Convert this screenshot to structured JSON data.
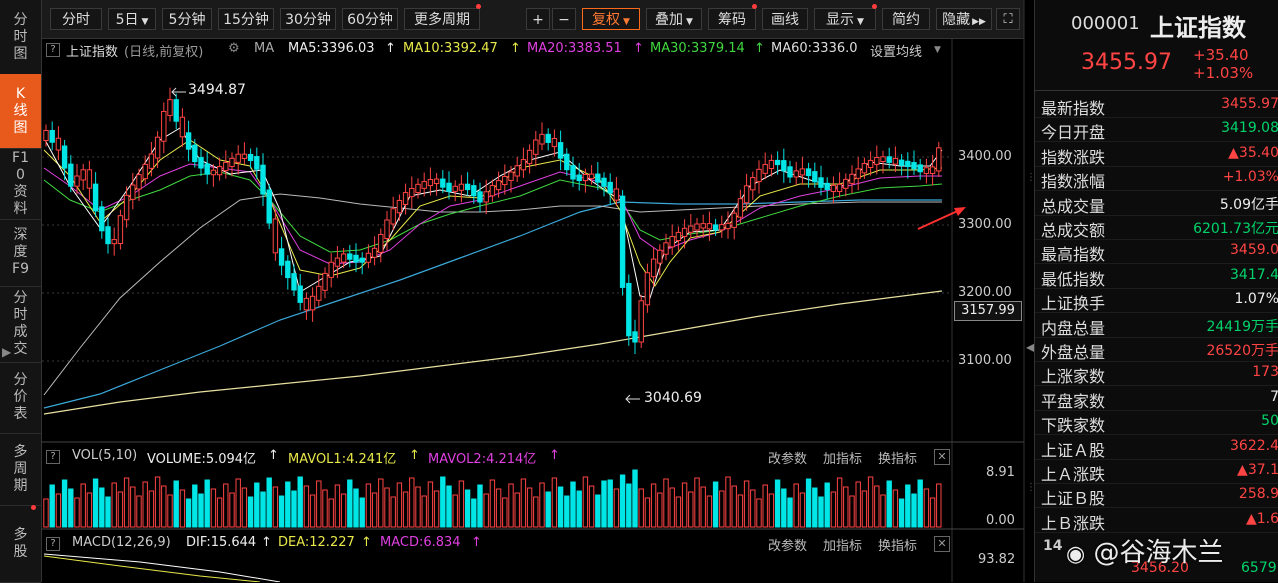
{
  "left_nav": [
    {
      "label": "分时图",
      "active": false
    },
    {
      "label": "K线图",
      "active": true
    },
    {
      "label": "F10资料",
      "active": false
    },
    {
      "label": "深度F9",
      "active": false
    },
    {
      "label": "分时成交",
      "active": false
    },
    {
      "label": "分价表",
      "active": false
    },
    {
      "label": "多周期",
      "active": false
    },
    {
      "label": "多股",
      "active": false
    }
  ],
  "toolbar": {
    "periods": [
      "分时",
      "5日",
      "5分钟",
      "15分钟",
      "30分钟",
      "60分钟",
      "更多周期"
    ],
    "fuquan": "复权",
    "diejia": "叠加",
    "chouma": "筹码",
    "huaxian": "画线",
    "xianshi": "显示",
    "jianyue": "简约",
    "yincang": "隐藏",
    "plus": "+",
    "minus": "−"
  },
  "chart_header": {
    "name": "上证指数",
    "mode": "(日线,前复权)",
    "ma_label": "MA",
    "ma5": "MA5:3396.03",
    "ma10": "MA10:3392.47",
    "ma20": "MA20:3383.51",
    "ma30": "MA30:3379.14",
    "ma60": "MA60:3336.0",
    "settings": "设置均线"
  },
  "annotations": {
    "high": "3494.87",
    "low": "3040.69"
  },
  "y_axis": [
    "3400.00",
    "3300.00",
    "3200.00",
    "3100.00"
  ],
  "current_price_tag": "3157.99",
  "volume_panel": {
    "title": "VOL(5,10)",
    "volume": "VOLUME:5.094亿",
    "mavol1": "MAVOL1:4.241亿",
    "mavol2": "MAVOL2:4.214亿",
    "buttons": [
      "改参数",
      "加指标",
      "换指标"
    ],
    "axis_top": "8.91",
    "axis_bottom": "0.00"
  },
  "macd_panel": {
    "title": "MACD(12,26,9)",
    "dif": "DIF:15.644",
    "dea": "DEA:12.227",
    "macd": "MACD:6.834",
    "buttons": [
      "改参数",
      "加指标",
      "换指标"
    ],
    "axis_top": "93.82"
  },
  "quote": {
    "code": "000001",
    "name": "上证指数",
    "price": "3455.97",
    "change": "+35.40",
    "change_pct": "+1.03%"
  },
  "stats": [
    {
      "label": "最新指数",
      "value": "3455.97",
      "color": "red"
    },
    {
      "label": "今日开盘",
      "value": "3419.08",
      "color": "green"
    },
    {
      "label": "指数涨跌",
      "value": "▲35.40",
      "color": "red"
    },
    {
      "label": "指数涨幅",
      "value": "+1.03%",
      "color": "red"
    },
    {
      "label": "总成交量",
      "value": "5.09亿手",
      "color": "white"
    },
    {
      "label": "总成交额",
      "value": "6201.73亿元",
      "color": "green"
    },
    {
      "label": "最高指数",
      "value": "3459.0",
      "color": "red"
    },
    {
      "label": "最低指数",
      "value": "3417.4",
      "color": "green"
    },
    {
      "label": "上证换手",
      "value": "1.07%",
      "color": "white"
    },
    {
      "label": "内盘总量",
      "value": "24419万手",
      "color": "green"
    },
    {
      "label": "外盘总量",
      "value": "26520万手",
      "color": "red"
    },
    {
      "label": "上涨家数",
      "value": "173",
      "color": "red"
    },
    {
      "label": "平盘家数",
      "value": "7",
      "color": "white"
    },
    {
      "label": "下跌家数",
      "value": "50",
      "color": "green"
    },
    {
      "label": "上证Ａ股",
      "value": "3622.4",
      "color": "red"
    },
    {
      "label": "上Ａ涨跌",
      "value": "▲37.1",
      "color": "red"
    },
    {
      "label": "上证Ｂ股",
      "value": "258.9",
      "color": "red"
    },
    {
      "label": "上Ｂ涨跌",
      "value": "▲1.6",
      "color": "red"
    }
  ],
  "bottom_row": {
    "left": "14",
    "right": "3456.20",
    "far": "6579"
  },
  "watermark": "@谷海木兰",
  "colors": {
    "up": "#ff4444",
    "down": "#00e5e5",
    "accent": "#e85a1c"
  }
}
